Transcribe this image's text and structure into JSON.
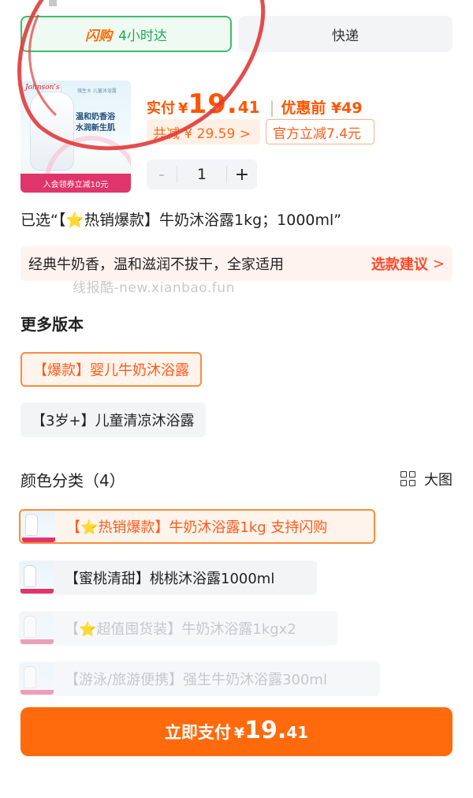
{
  "delivery_tabs": {
    "flash_brand": "闪购",
    "flash_time": "4小时达",
    "express": "快递"
  },
  "product": {
    "image": {
      "logo": "Johnson's",
      "tag": "强生® 儿童沐浴露",
      "text_line1": "温和奶香浴",
      "text_line2": "水润新生肌",
      "ribbon": "入会领券立减10元"
    },
    "price_label": "实付",
    "currency": "¥",
    "price_int": "19.",
    "price_dec": "41",
    "price_separator": "|",
    "original_price": "优惠前 ¥49",
    "total_discount": "共减 ¥ 29.59 >",
    "official_discount": "官方立减7.4元",
    "quantity": "1",
    "minus": "-",
    "plus": "+"
  },
  "selected_text": "已选“【⭐热销爆款】牛奶沐浴露1kg；1000ml”",
  "tip": {
    "text": "经典牛奶香，温和滋润不拔干，全家适用",
    "link": "选款建议",
    "chevron": ">"
  },
  "watermark": "线报酷-new.xianbao.fun",
  "versions": {
    "title": "更多版本",
    "items": [
      {
        "label": "【爆款】婴儿牛奶沐浴露",
        "selected": true
      },
      {
        "label": "【3岁+】儿童清凉沐浴露",
        "selected": false
      }
    ]
  },
  "colors": {
    "title": "颜色分类（4）",
    "big_view": "大图",
    "items": [
      {
        "label": "【⭐热销爆款】牛奶沐浴露1kg  支持闪购",
        "state": "selected"
      },
      {
        "label": "【蜜桃清甜】桃桃沐浴露1000ml",
        "state": "normal"
      },
      {
        "label": "【⭐超值囤货装】牛奶沐浴露1kgx2",
        "state": "disabled"
      },
      {
        "label": "【游泳/旅游便携】强生牛奶沐浴露300ml",
        "state": "disabled"
      }
    ]
  },
  "pay_button": {
    "label": "立即支付",
    "currency": "¥",
    "int": "19.",
    "dec": "41"
  },
  "colors_theme": {
    "accent_orange": "#ff6a0d",
    "price_red": "#ff5500",
    "flash_green": "#3cbf6a",
    "annotation_red": "#e03a3a"
  }
}
